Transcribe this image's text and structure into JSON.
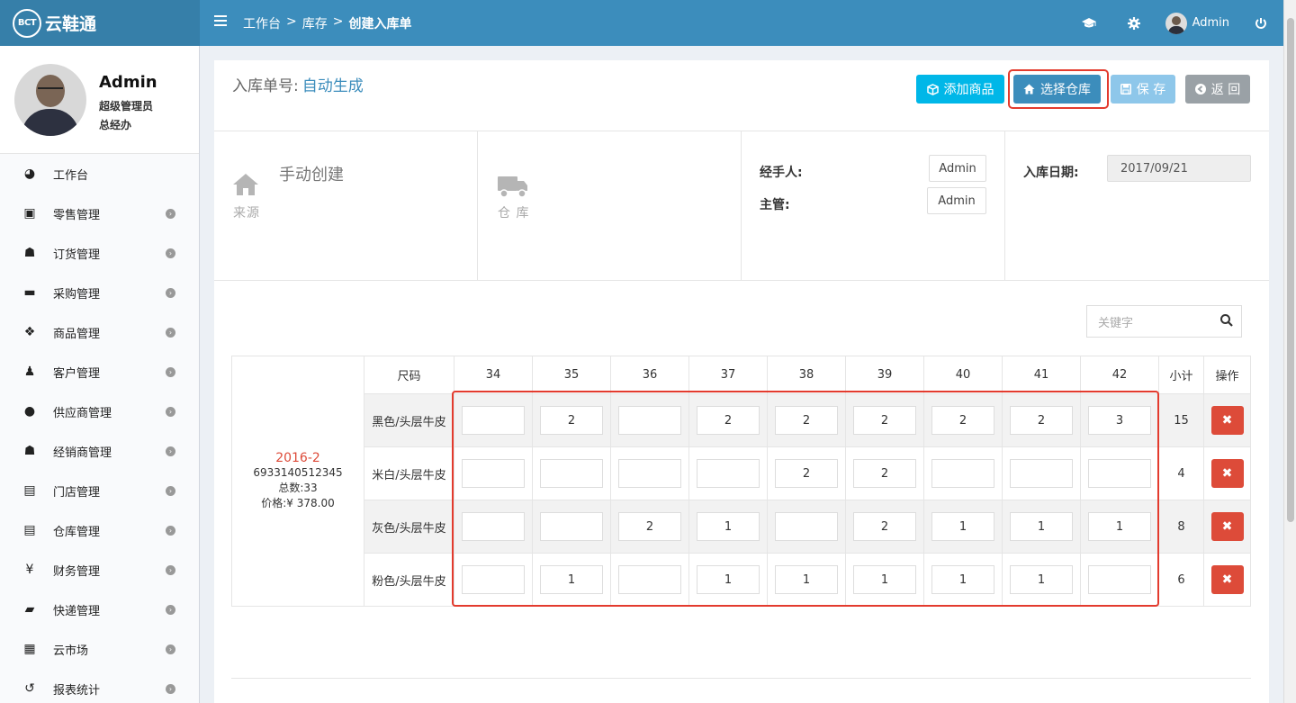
{
  "app": {
    "logo_badge": "BCT",
    "logo_text": "云鞋通"
  },
  "breadcrumb": {
    "items": [
      "工作台",
      "库存",
      "创建入库单"
    ],
    "sep": ">"
  },
  "topbar": {
    "user_name": "Admin",
    "icons": [
      "graduation-cap-icon",
      "gear-icon",
      "power-icon"
    ]
  },
  "profile": {
    "name": "Admin",
    "role": "超级管理员",
    "dept": "总经办"
  },
  "menu": [
    {
      "label": "工作台",
      "icon": "dashboard-icon",
      "glyph": "◕",
      "arrow": false
    },
    {
      "label": "零售管理",
      "icon": "money-icon",
      "glyph": "▣",
      "arrow": true
    },
    {
      "label": "订货管理",
      "icon": "users-icon",
      "glyph": "☗",
      "arrow": true
    },
    {
      "label": "采购管理",
      "icon": "cart-icon",
      "glyph": "▬",
      "arrow": true
    },
    {
      "label": "商品管理",
      "icon": "cubes-icon",
      "glyph": "❖",
      "arrow": true
    },
    {
      "label": "客户管理",
      "icon": "person-icon",
      "glyph": "♟",
      "arrow": true
    },
    {
      "label": "供应商管理",
      "icon": "user-icon",
      "glyph": "●",
      "arrow": true
    },
    {
      "label": "经销商管理",
      "icon": "group-icon",
      "glyph": "☗",
      "arrow": true
    },
    {
      "label": "门店管理",
      "icon": "archive-icon",
      "glyph": "▤",
      "arrow": true
    },
    {
      "label": "仓库管理",
      "icon": "archive-icon",
      "glyph": "▤",
      "arrow": true
    },
    {
      "label": "财务管理",
      "icon": "yen-icon",
      "glyph": "¥",
      "arrow": true
    },
    {
      "label": "快递管理",
      "icon": "truck-icon",
      "glyph": "▰",
      "arrow": true
    },
    {
      "label": "云市场",
      "icon": "building-icon",
      "glyph": "▦",
      "arrow": true
    },
    {
      "label": "报表统计",
      "icon": "history-icon",
      "glyph": "↺",
      "arrow": true
    }
  ],
  "order": {
    "label": "入库单号:",
    "value": "自动生成"
  },
  "actions": {
    "add": "添加商品",
    "warehouse": "选择仓库",
    "save": "保 存",
    "back": "返 回"
  },
  "info": {
    "source_caption": "来源",
    "source_value": "手动创建",
    "warehouse_caption": "仓 库",
    "handler_label": "经手人:",
    "handler_value": "Admin",
    "manager_label": "主管:",
    "manager_value": "Admin",
    "date_label": "入库日期:",
    "date_value": "2017/09/21"
  },
  "search": {
    "placeholder": "关键字"
  },
  "table": {
    "size_header": "尺码",
    "sizes": [
      "34",
      "35",
      "36",
      "37",
      "38",
      "39",
      "40",
      "41",
      "42"
    ],
    "subtotal_header": "小计",
    "op_header": "操作",
    "product": {
      "code": "2016-2",
      "barcode": "6933140512345",
      "total": "总数:33",
      "price": "价格:¥ 378.00"
    },
    "rows": [
      {
        "color": "黑色/头层牛皮",
        "qty": [
          "",
          "2",
          "",
          "2",
          "2",
          "2",
          "2",
          "2",
          "3"
        ],
        "subtotal": "15"
      },
      {
        "color": "米白/头层牛皮",
        "qty": [
          "",
          "",
          "",
          "",
          "2",
          "2",
          "",
          "",
          ""
        ],
        "subtotal": "4"
      },
      {
        "color": "灰色/头层牛皮",
        "qty": [
          "",
          "",
          "2",
          "1",
          "",
          "2",
          "1",
          "1",
          "1"
        ],
        "subtotal": "8"
      },
      {
        "color": "粉色/头层牛皮",
        "qty": [
          "",
          "1",
          "",
          "1",
          "1",
          "1",
          "1",
          "1",
          ""
        ],
        "subtotal": "6"
      }
    ],
    "delete_glyph": "✖"
  },
  "colors": {
    "topbar": "#3c8dbc",
    "accent": "#00b7e8",
    "danger": "#dd4b39",
    "highlight": "#e33b2e"
  }
}
